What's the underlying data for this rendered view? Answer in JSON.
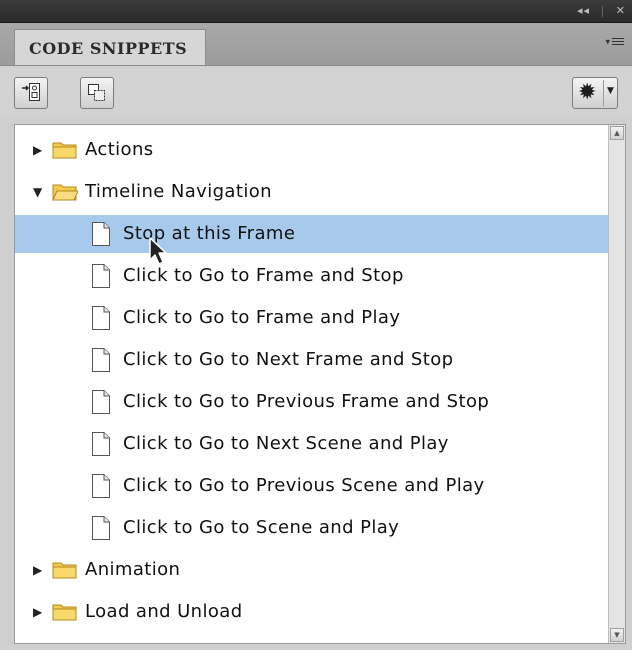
{
  "window": {
    "controls": {
      "collapse": "◂◂",
      "close": "✕"
    }
  },
  "panel": {
    "tab_label": "CODE SNIPPETS",
    "menu_icon": "panel-menu-icon"
  },
  "toolbar": {
    "buttons": [
      {
        "icon": "add-to-current-frame-icon"
      },
      {
        "icon": "copy-to-clipboard-icon"
      }
    ],
    "options_icon": "gear-icon"
  },
  "tree": {
    "items": [
      {
        "type": "folder",
        "expanded": false,
        "label": "Actions"
      },
      {
        "type": "folder",
        "expanded": true,
        "label": "Timeline Navigation"
      },
      {
        "type": "snippet",
        "label": "Stop at this Frame",
        "selected": true
      },
      {
        "type": "snippet",
        "label": "Click to Go to Frame and Stop"
      },
      {
        "type": "snippet",
        "label": "Click to Go to Frame and Play"
      },
      {
        "type": "snippet",
        "label": "Click to Go to Next Frame and Stop"
      },
      {
        "type": "snippet",
        "label": "Click to Go to Previous Frame and Stop"
      },
      {
        "type": "snippet",
        "label": "Click to Go to Next Scene and Play"
      },
      {
        "type": "snippet",
        "label": "Click to Go to Previous Scene and Play"
      },
      {
        "type": "snippet",
        "label": "Click to Go to Scene and Play"
      },
      {
        "type": "folder",
        "expanded": false,
        "label": "Animation"
      },
      {
        "type": "folder",
        "expanded": false,
        "label": "Load and Unload"
      }
    ]
  },
  "colors": {
    "selection": "#a7c9ec",
    "folder": "#f2c94c"
  }
}
